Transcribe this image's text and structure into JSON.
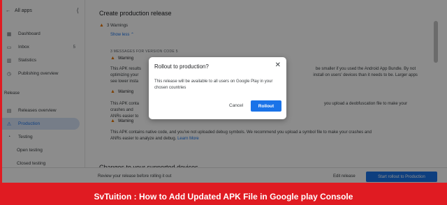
{
  "sidebar": {
    "back_label": "All apps",
    "items": [
      {
        "label": "Dashboard",
        "icon": "dashboard-icon",
        "glyph": "▦"
      },
      {
        "label": "Inbox",
        "icon": "inbox-icon",
        "glyph": "▭",
        "count": "5"
      },
      {
        "label": "Statistics",
        "icon": "statistics-icon",
        "glyph": "▥"
      },
      {
        "label": "Publishing overview",
        "icon": "publishing-icon",
        "glyph": "◷"
      }
    ],
    "section_release": "Release",
    "release_items": [
      {
        "label": "Releases overview",
        "glyph": "▤"
      },
      {
        "label": "Production",
        "glyph": "⚠"
      },
      {
        "label": "Testing",
        "glyph": "◔"
      },
      {
        "label": "Open testing"
      },
      {
        "label": "Closed testing"
      }
    ]
  },
  "main": {
    "title": "Create production release",
    "warnings_count": "3 Warnings",
    "show_less": "Show less",
    "messages_header": "3 MESSAGES FOR VERSION CODE 5",
    "warning_label": "Warning",
    "warning1_left": "This APK results",
    "warning1_right": "be smaller if you used the Android App Bundle. By not",
    "warning1_line2_left": "optimizing your",
    "warning1_line2_right": "install on users' devices than it needs to be. Larger apps",
    "warning1_line3_left": "see lower insta",
    "warning2_left": "This APK conta",
    "warning2_right": "you upload a deobfuscation file to make your crashes and",
    "warning2_line2": "ANRs easier to",
    "warning3_line1": "This APK contains native code, and you've not uploaded debug symbols. We recommend you upload a symbol file to make your crashes and",
    "warning3_line2": "ANRs easier to analyze and debug.",
    "learn_more": "Learn More",
    "changes_heading": "Changes to your supported devices"
  },
  "bottom_bar": {
    "review_text": "Review your release before rolling it out",
    "edit_release": "Edit release",
    "start_rollout": "Start rollout to Production"
  },
  "dialog": {
    "title": "Rollout to production?",
    "body": "This release will be available to all users on Google Play in your chosen countries",
    "cancel": "Cancel",
    "rollout": "Rollout"
  },
  "caption": "SvTuition : How to Add Updated APK File in Google play Console",
  "colors": {
    "accent": "#1a73e8",
    "border_red": "#e01b22",
    "warning": "#e37400"
  }
}
